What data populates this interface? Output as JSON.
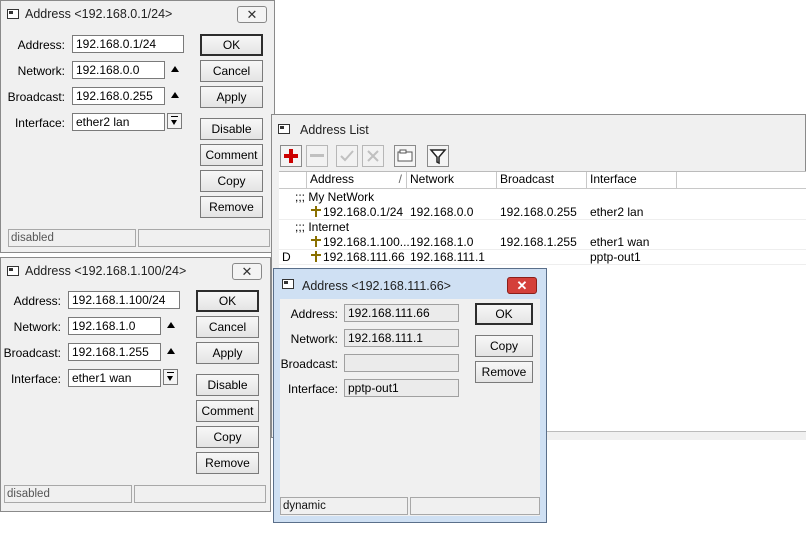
{
  "dialog1": {
    "title": "Address <192.168.0.1/24>",
    "fields": {
      "address": {
        "label": "Address:",
        "value": "192.168.0.1/24"
      },
      "network": {
        "label": "Network:",
        "value": "192.168.0.0"
      },
      "broadcast": {
        "label": "Broadcast:",
        "value": "192.168.0.255"
      },
      "interface": {
        "label": "Interface:",
        "value": "ether2 lan"
      }
    },
    "buttons": {
      "ok": "OK",
      "cancel": "Cancel",
      "apply": "Apply",
      "disable": "Disable",
      "comment": "Comment",
      "copy": "Copy",
      "remove": "Remove"
    },
    "status": "disabled"
  },
  "dialog2": {
    "title": "Address <192.168.1.100/24>",
    "fields": {
      "address": {
        "label": "Address:",
        "value": "192.168.1.100/24"
      },
      "network": {
        "label": "Network:",
        "value": "192.168.1.0"
      },
      "broadcast": {
        "label": "Broadcast:",
        "value": "192.168.1.255"
      },
      "interface": {
        "label": "Interface:",
        "value": "ether1 wan"
      }
    },
    "buttons": {
      "ok": "OK",
      "cancel": "Cancel",
      "apply": "Apply",
      "disable": "Disable",
      "comment": "Comment",
      "copy": "Copy",
      "remove": "Remove"
    },
    "status": "disabled"
  },
  "address_list": {
    "title": "Address List",
    "toolbar_icons": [
      "add-icon",
      "remove-icon",
      "enable-icon",
      "disable-icon",
      "comment-icon",
      "filter-icon"
    ],
    "columns": [
      "Address",
      "Network",
      "Broadcast",
      "Interface"
    ],
    "rows": [
      {
        "flag": "",
        "comment": ";;; My NetWork"
      },
      {
        "flag": "",
        "address": "192.168.0.1/24",
        "network": "192.168.0.0",
        "broadcast": "192.168.0.255",
        "interface": "ether2 lan"
      },
      {
        "flag": "",
        "comment": ";;; Internet"
      },
      {
        "flag": "",
        "address": "192.168.1.100...",
        "network": "192.168.1.0",
        "broadcast": "192.168.1.255",
        "interface": "ether1 wan"
      },
      {
        "flag": "D",
        "address": "192.168.111.66",
        "network": "192.168.111.1",
        "broadcast": "",
        "interface": "pptp-out1"
      }
    ]
  },
  "dialog3": {
    "title": "Address <192.168.111.66>",
    "fields": {
      "address": {
        "label": "Address:",
        "value": "192.168.111.66"
      },
      "network": {
        "label": "Network:",
        "value": "192.168.111.1"
      },
      "broadcast": {
        "label": "Broadcast:",
        "value": ""
      },
      "interface": {
        "label": "Interface:",
        "value": "pptp-out1"
      }
    },
    "buttons": {
      "ok": "OK",
      "copy": "Copy",
      "remove": "Remove"
    },
    "status": "dynamic"
  },
  "colors": {
    "window_frame": "#cfe0f3",
    "add_icon": "#cc0000",
    "close_active": "#d4403a"
  }
}
